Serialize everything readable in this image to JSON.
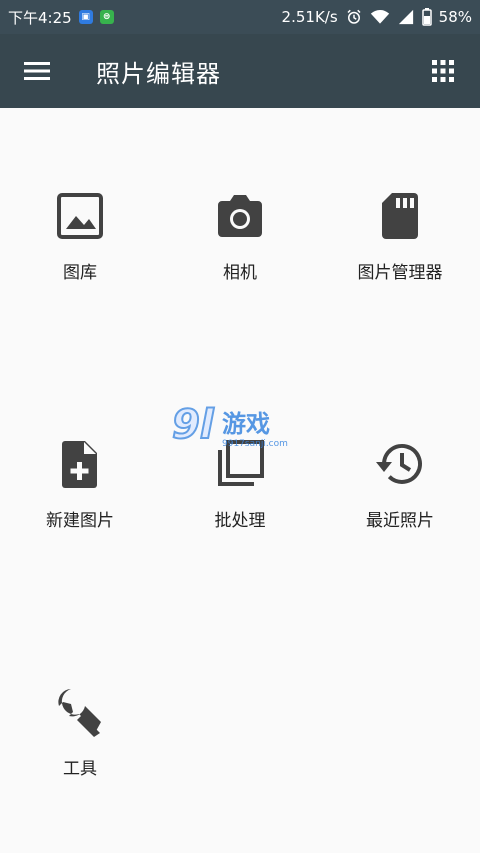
{
  "status_bar": {
    "time": "下午4:25",
    "network_speed": "2.51K/s",
    "battery": "58%",
    "icons": [
      "notification-app-icon",
      "notification-chat-icon",
      "alarm-icon",
      "wifi-icon",
      "signal-icon",
      "battery-icon"
    ]
  },
  "toolbar": {
    "title": "照片编辑器",
    "menu_icon": "hamburger-menu-icon",
    "apps_icon": "grid-apps-icon",
    "background": "#37474f"
  },
  "tiles": [
    {
      "label": "图库",
      "icon": "image-icon"
    },
    {
      "label": "相机",
      "icon": "camera-icon"
    },
    {
      "label": "图片管理器",
      "icon": "sd-card-icon"
    },
    {
      "label": "新建图片",
      "icon": "new-file-icon"
    },
    {
      "label": "批处理",
      "icon": "batch-layers-icon"
    },
    {
      "label": "最近照片",
      "icon": "history-icon"
    },
    {
      "label": "工具",
      "icon": "wrench-icon"
    }
  ],
  "watermark": {
    "brand": "9l游戏",
    "url": "9917sanji.com"
  }
}
